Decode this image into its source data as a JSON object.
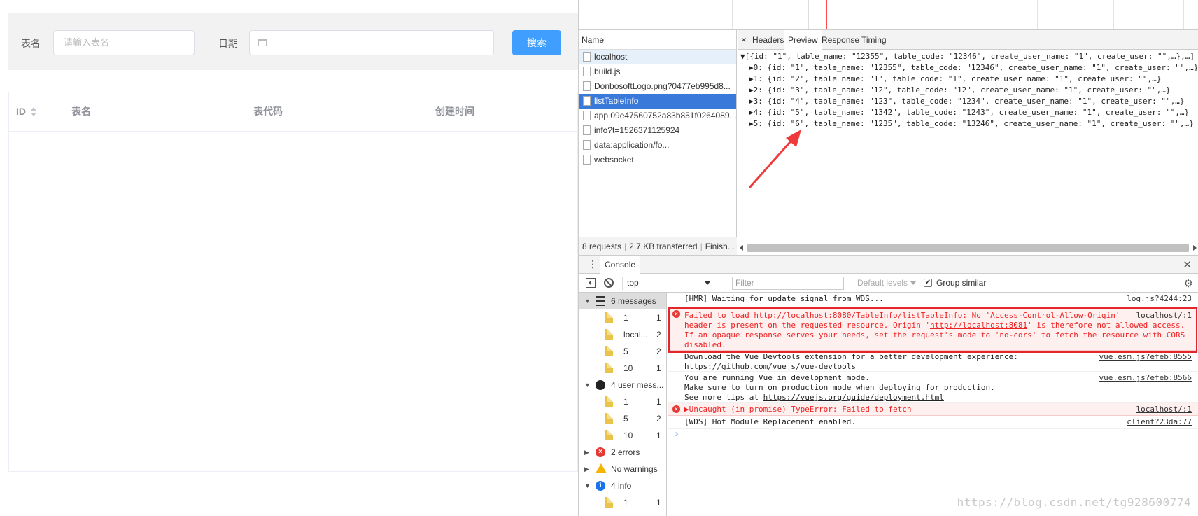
{
  "app": {
    "table_name_label": "表名",
    "table_name_placeholder": "请输入表名",
    "date_label": "日期",
    "date_separator": "-",
    "search_button": "搜索",
    "columns": [
      "ID",
      "表名",
      "表代码",
      "创建时间"
    ]
  },
  "network": {
    "name_header": "Name",
    "requests": [
      {
        "name": "localhost",
        "state": "first"
      },
      {
        "name": "build.js",
        "state": ""
      },
      {
        "name": "DonbosoftLogo.png?0477eb995d8...",
        "state": ""
      },
      {
        "name": "listTableInfo",
        "state": "selected"
      },
      {
        "name": "app.09e47560752a83b851f0264089...",
        "state": ""
      },
      {
        "name": "info?t=1526371125924",
        "state": ""
      },
      {
        "name": "data:application/fo...",
        "state": ""
      },
      {
        "name": "websocket",
        "state": ""
      }
    ],
    "summary": {
      "requests": "8 requests",
      "transferred": "2.7 KB transferred",
      "finish": "Finish..."
    },
    "tabs": {
      "close": "×",
      "headers": "Headers",
      "preview": "Preview",
      "response": "Response",
      "timing": "Timing"
    },
    "preview_lines": [
      "▼[{id: \"1\", table_name: \"12355\", table_code: \"12346\", create_user_name: \"1\", create_user: \"\",…},…]",
      "▶0: {id: \"1\", table_name: \"12355\", table_code: \"12346\", create_user_name: \"1\", create_user: \"\",…}",
      "▶1: {id: \"2\", table_name: \"1\", table_code: \"1\", create_user_name: \"1\", create_user: \"\",…}",
      "▶2: {id: \"3\", table_name: \"12\", table_code: \"12\", create_user_name: \"1\", create_user: \"\",…}",
      "▶3: {id: \"4\", table_name: \"123\", table_code: \"1234\", create_user_name: \"1\", create_user: \"\",…}",
      "▶4: {id: \"5\", table_name: \"1342\", table_code: \"1243\", create_user_name: \"1\", create_user: \"\",…}",
      "▶5: {id: \"6\", table_name: \"1235\", table_code: \"13246\", create_user_name: \"1\", create_user: \"\",…}"
    ]
  },
  "console": {
    "tab": "Console",
    "context": "top",
    "filter_placeholder": "Filter",
    "levels": "Default levels",
    "group_similar": "Group similar",
    "sidebar": [
      {
        "kind": "group",
        "icon": "list",
        "expanded": "▼",
        "label": "6 messages",
        "selected": true
      },
      {
        "kind": "child",
        "label": "1",
        "count": "1"
      },
      {
        "kind": "child",
        "label": "local...",
        "count": "2"
      },
      {
        "kind": "child",
        "label": "5",
        "count": "2"
      },
      {
        "kind": "child",
        "label": "10",
        "count": "1"
      },
      {
        "kind": "group",
        "icon": "user",
        "expanded": "▼",
        "label": "4 user mess..."
      },
      {
        "kind": "child",
        "label": "1",
        "count": "1"
      },
      {
        "kind": "child",
        "label": "5",
        "count": "2"
      },
      {
        "kind": "child",
        "label": "10",
        "count": "1"
      },
      {
        "kind": "group",
        "icon": "error",
        "expanded": "▶",
        "label": "2 errors"
      },
      {
        "kind": "group",
        "icon": "warn",
        "expanded": "▶",
        "label": "No warnings"
      },
      {
        "kind": "group",
        "icon": "info",
        "expanded": "▼",
        "label": "4 info"
      },
      {
        "kind": "child",
        "label": "1",
        "count": "1"
      }
    ],
    "messages": {
      "hmr": {
        "text": "[HMR] Waiting for update signal from WDS...",
        "source": "log.js?4244:23"
      },
      "cors": {
        "l1_a": "Failed to load ",
        "l1_link": "http://localhost:8080/TableInfo/listTableInfo",
        "l1_b": ": No 'Access-Control-Allow-Origin'",
        "l2_a": "header is present on the requested resource. Origin '",
        "l2_link": "http://localhost:8081",
        "l2_b": "' is therefore not allowed access.",
        "l3": "If an opaque response serves your needs, set the request's mode to 'no-cors' to fetch the resource with CORS",
        "l4": "disabled.",
        "source": "localhost/:1"
      },
      "devtools": {
        "l1": "Download the Vue Devtools extension for a better development experience:",
        "l2": "https://github.com/vuejs/vue-devtools",
        "source": "vue.esm.js?efeb:8555"
      },
      "prodmode": {
        "l1": "You are running Vue in development mode.",
        "l2": "Make sure to turn on production mode when deploying for production.",
        "l3_a": "See more tips at ",
        "l3_link": "https://vuejs.org/guide/deployment.html",
        "source": "vue.esm.js?efeb:8566"
      },
      "uncaught": {
        "text": "▶Uncaught (in promise) TypeError: Failed to fetch",
        "source": "localhost/:1"
      },
      "wds": {
        "text": "[WDS] Hot Module Replacement enabled.",
        "source": "client?23da:77"
      }
    },
    "prompt": "›"
  },
  "watermark": "https://blog.csdn.net/tg928600774",
  "colors": {
    "primary": "#409eff",
    "selected_row": "#3879d9",
    "error_red": "#e3262b"
  }
}
